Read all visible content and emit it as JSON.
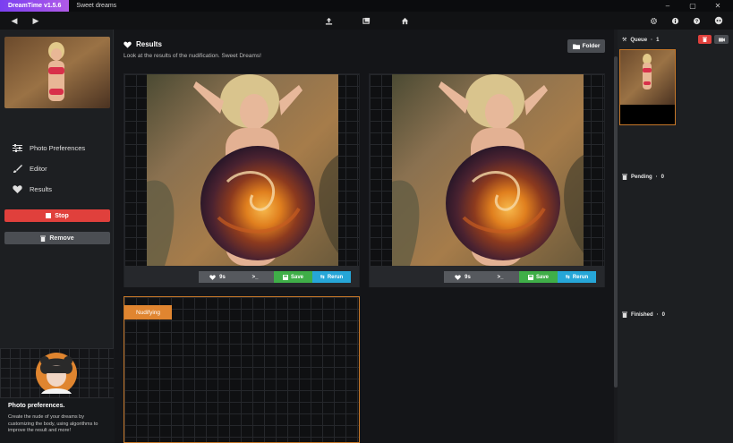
{
  "titlebar": {
    "app_badge": "DreamTime v1.5.6",
    "document_title": "Sweet dreams"
  },
  "sidebar": {
    "menu": [
      {
        "label": "Photo Preferences",
        "icon": "sliders-icon"
      },
      {
        "label": "Editor",
        "icon": "brush-icon"
      },
      {
        "label": "Results",
        "icon": "heart-icon"
      }
    ],
    "stop_label": "Stop",
    "remove_label": "Remove",
    "promo_title": "Photo preferences.",
    "promo_text": "Create the nude of your dreams by customizing the body, using algorithms to improve the result and more!"
  },
  "main": {
    "title": "Results",
    "subtitle": "Look at the results of the nudification. Sweet Dreams!",
    "folder_label": "Folder",
    "results": [
      {
        "like_label": "9s",
        "term_label": ">_",
        "save_label": "Save",
        "rerun_label": "Rerun"
      },
      {
        "like_label": "9s",
        "term_label": ">_",
        "save_label": "Save",
        "rerun_label": "Rerun"
      }
    ],
    "nudifying_label": "Nudifying"
  },
  "queue": {
    "queue_label": "Queue",
    "queue_count": "1",
    "pending_label": "Pending",
    "pending_count": "0",
    "finished_label": "Finished",
    "finished_count": "0",
    "separator": "·"
  },
  "colors": {
    "accent_purple": "#7a3ff0",
    "stop_red": "#e0403c",
    "save_green": "#3fae48",
    "rerun_blue": "#26a6d8",
    "nudify_orange": "#e08530"
  }
}
